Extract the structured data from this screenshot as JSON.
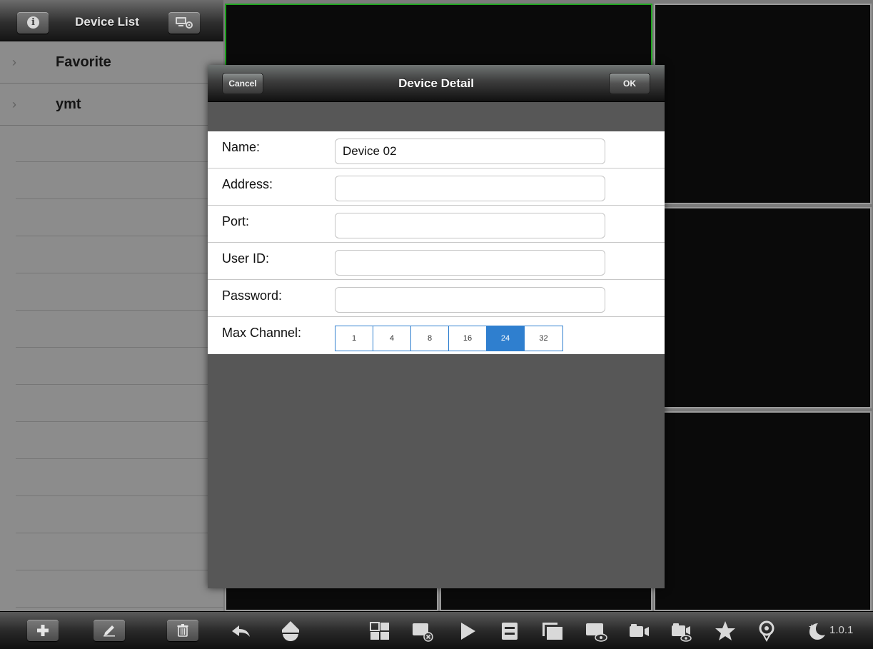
{
  "sidebar": {
    "title": "Device List",
    "groups": [
      {
        "label": "Favorite"
      },
      {
        "label": "ymt"
      }
    ]
  },
  "dialog": {
    "title": "Device Detail",
    "cancel_label": "Cancel",
    "ok_label": "OK",
    "fields": {
      "name": {
        "label": "Name:",
        "value": "Device 02"
      },
      "address": {
        "label": "Address:",
        "value": ""
      },
      "port": {
        "label": "Port:",
        "value": ""
      },
      "user_id": {
        "label": "User ID:",
        "value": ""
      },
      "password": {
        "label": "Password:",
        "value": ""
      }
    },
    "max_channel": {
      "label": "Max Channel:",
      "options": [
        "1",
        "4",
        "8",
        "16",
        "24",
        "32"
      ],
      "selected": "24"
    }
  },
  "toolbar": {
    "version": "1.0.1",
    "icons": [
      "add-icon",
      "edit-icon",
      "delete-icon",
      "back-arrow-icon",
      "ptz-icon",
      "layout-icon",
      "close-view-icon",
      "play-icon",
      "switch-icon",
      "fullscreen-icon",
      "view-icon",
      "record-icon",
      "record-view-icon",
      "favorite-star-icon",
      "location-icon",
      "night-mode-icon"
    ]
  },
  "colors": {
    "active_cell_border": "#1ea51e",
    "segment_selected": "#2f7fcf"
  }
}
